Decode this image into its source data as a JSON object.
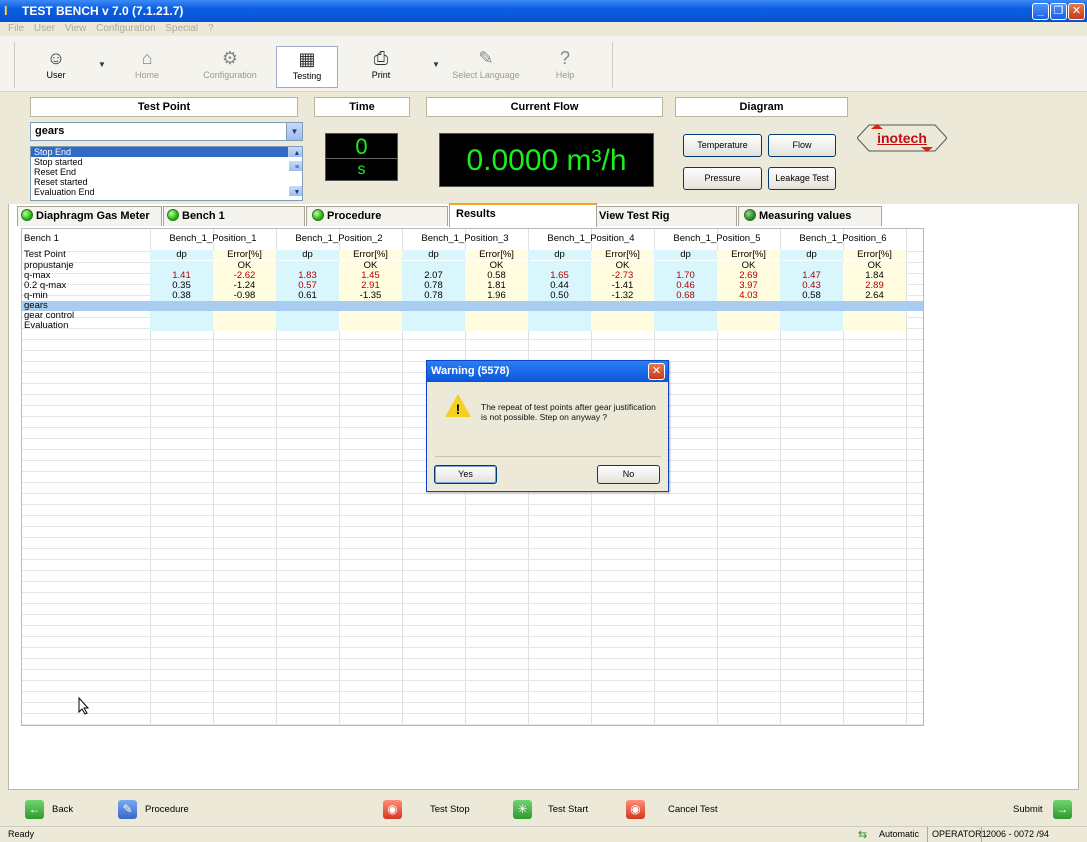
{
  "window": {
    "title": "TEST BENCH v 7.0 (7.1.21.7)"
  },
  "menu": [
    "File",
    "User",
    "View",
    "Configuration",
    "Special",
    "?"
  ],
  "toolbar": {
    "user": "User",
    "home": "Home",
    "configuration": "Configuration",
    "testing": "Testing",
    "print": "Print",
    "select_language": "Select Language",
    "help": "Help"
  },
  "test_point": {
    "header": "Test Point",
    "selected": "gears",
    "list": [
      "Stop End",
      "Stop started",
      "Reset End",
      "Reset started",
      "Evaluation End"
    ]
  },
  "time": {
    "header": "Time",
    "value": "0",
    "unit": "s"
  },
  "current_flow": {
    "header": "Current Flow",
    "value": "0.0000 m³/h"
  },
  "diagram": {
    "header": "Diagram",
    "temperature": "Temperature",
    "flow": "Flow",
    "pressure": "Pressure",
    "leakage_test": "Leakage Test"
  },
  "logo": "inotech",
  "tabs": [
    "Diaphragm Gas Meter",
    "Bench 1",
    "Procedure",
    "Results",
    "View Test Rig",
    "Measuring values"
  ],
  "grid": {
    "header1": [
      "Bench 1",
      "Bench_1_Position_1",
      "Bench_1_Position_2",
      "Bench_1_Position_3",
      "Bench_1_Position_4",
      "Bench_1_Position_5",
      "Bench_1_Position_6"
    ],
    "header2": [
      "Test Point",
      "dp",
      "Error[%]",
      "dp",
      "Error[%]",
      "dp",
      "Error[%]",
      "dp",
      "Error[%]",
      "dp",
      "Error[%]",
      "dp",
      "Error[%]"
    ],
    "rows": [
      [
        "propustanje",
        "",
        "OK",
        "",
        "OK",
        "",
        "OK",
        "",
        "OK",
        "",
        "OK",
        "",
        "OK"
      ],
      [
        "q-max",
        "1.41",
        "-2.62",
        "1.83",
        "1.45",
        "2.07",
        "0.58",
        "1.65",
        "-2.73",
        "1.70",
        "2.69",
        "1.47",
        "1.84"
      ],
      [
        "0.2 q-max",
        "0.35",
        "-1.24",
        "0.57",
        "2.91",
        "0.78",
        "1.81",
        "0.44",
        "-1.41",
        "0.46",
        "3.97",
        "0.43",
        "2.89"
      ],
      [
        "q-min",
        "0.38",
        "-0.98",
        "0.61",
        "-1.35",
        "0.78",
        "1.96",
        "0.50",
        "-1.32",
        "0.68",
        "4.03",
        "0.58",
        "2.64"
      ],
      [
        "gears",
        "",
        "",
        "",
        "",
        "",
        "",
        "",
        "",
        "",
        "",
        "",
        ""
      ],
      [
        "gear control",
        "",
        "",
        "",
        "",
        "",
        "",
        "",
        "",
        "",
        "",
        "",
        ""
      ],
      [
        "Evaluation",
        "",
        "",
        "",
        "",
        "",
        "",
        "",
        "",
        "",
        "",
        "",
        ""
      ]
    ]
  },
  "dialog": {
    "title": "Warning (5578)",
    "message": "The repeat of test points after gear justification is not possible. Step on anyway ?",
    "yes": "Yes",
    "no": "No"
  },
  "bottom": {
    "back": "Back",
    "procedure": "Procedure",
    "test_stop": "Test Stop",
    "test_start": "Test Start",
    "cancel_test": "Cancel Test",
    "submit": "Submit"
  },
  "status": {
    "left": "Ready",
    "mode": "Automatic",
    "operator": "OPERATOR1",
    "code": "2006 - 0072 /94"
  }
}
